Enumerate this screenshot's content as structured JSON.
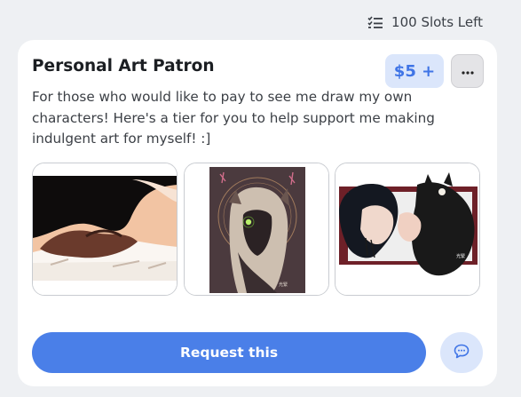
{
  "header": {
    "slots_icon": "checklist-icon",
    "slots_text": "100 Slots Left"
  },
  "tier": {
    "title": "Personal Art Patron",
    "price_label": "$5 +",
    "more_icon": "more-dots-icon",
    "more_label": "···",
    "description": "For those who would like to pay to see me draw my own characters! Here's a tier for you to help support me making indulgent art for myself! :]",
    "thumbnails": [
      {
        "name": "artwork-thumbnail-1"
      },
      {
        "name": "artwork-thumbnail-2"
      },
      {
        "name": "artwork-thumbnail-3"
      }
    ],
    "request_label": "Request this",
    "chat_icon": "chat-bubble-icon"
  },
  "colors": {
    "accent": "#4a7fe8",
    "accent_soft": "#dbe6fb",
    "background": "#eef0f3",
    "card": "#ffffff"
  }
}
